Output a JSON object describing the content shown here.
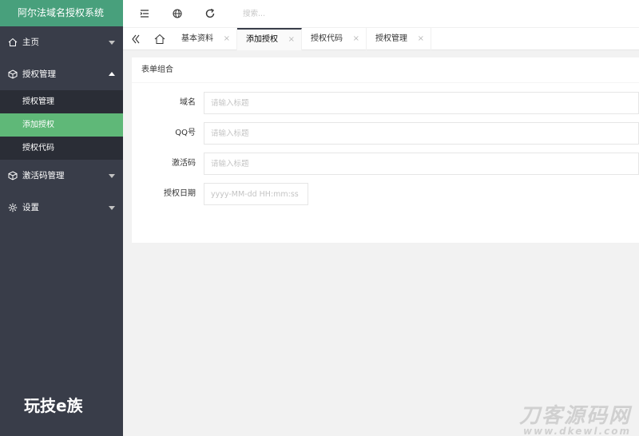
{
  "app": {
    "title": "阿尔法域名授权系统"
  },
  "sidebar": {
    "items": [
      {
        "label": "主页"
      },
      {
        "label": "授权管理"
      },
      {
        "label": "激活码管理"
      },
      {
        "label": "设置"
      }
    ],
    "submenu": [
      {
        "label": "授权管理"
      },
      {
        "label": "添加授权"
      },
      {
        "label": "授权代码"
      }
    ],
    "watermark": "玩技e族"
  },
  "header": {
    "search_placeholder": "搜索..."
  },
  "tabs": [
    {
      "label": "基本资料",
      "close": "×"
    },
    {
      "label": "添加授权",
      "close": "×"
    },
    {
      "label": "授权代码",
      "close": "×"
    },
    {
      "label": "授权管理",
      "close": "×"
    }
  ],
  "card": {
    "title": "表单组合",
    "fields": [
      {
        "label": "域名",
        "placeholder": "请输入标题"
      },
      {
        "label": "QQ号",
        "placeholder": "请输入标题"
      },
      {
        "label": "激活码",
        "placeholder": "请输入标题"
      },
      {
        "label": "授权日期",
        "placeholder": "yyyy-MM-dd HH:mm:ss"
      }
    ]
  },
  "watermark_right": {
    "line1": "刀客源码网",
    "line2": "www.dkewl.com"
  },
  "colors": {
    "sidebar": "#393d49",
    "logo": "#48a07c",
    "active_sub": "#5fb878",
    "submenu": "#2a2d36"
  }
}
